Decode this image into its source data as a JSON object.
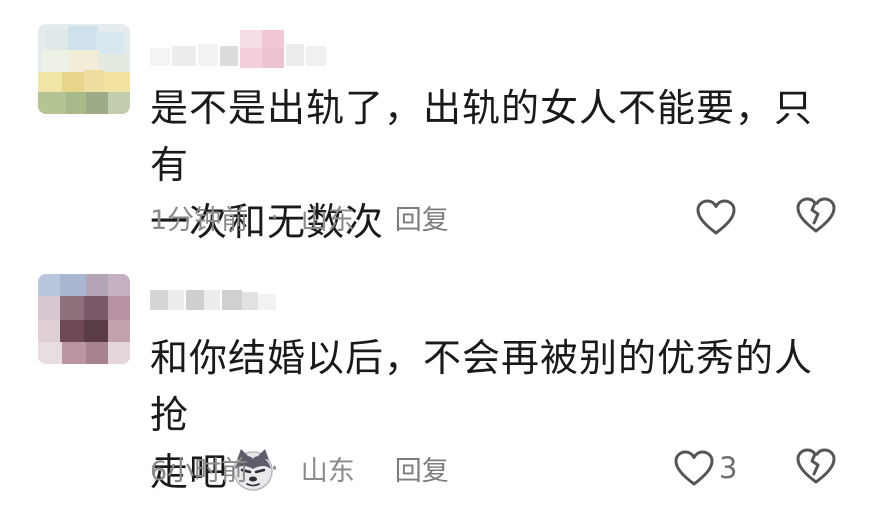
{
  "comments": [
    {
      "text_line1": "是不是出轨了，出轨的女人不能要，只有",
      "text_line2": "一次和无数次",
      "time": "1分钟前",
      "separator": "·",
      "location": "山东",
      "reply_label": "回复",
      "likes": ""
    },
    {
      "text_line1": "和你结婚以后，不会再被别的优秀的人抢",
      "text_line2": "走吧",
      "emoji": "wolf-emoji",
      "time": "6小时前",
      "separator": "·",
      "location": "山东",
      "reply_label": "回复",
      "likes": "3"
    }
  ],
  "icons": {
    "like": "heart-outline-icon",
    "dislike": "broken-heart-icon"
  },
  "colors": {
    "text": "#1a1a1a",
    "meta": "#8a8a8a",
    "icon": "#555555"
  }
}
